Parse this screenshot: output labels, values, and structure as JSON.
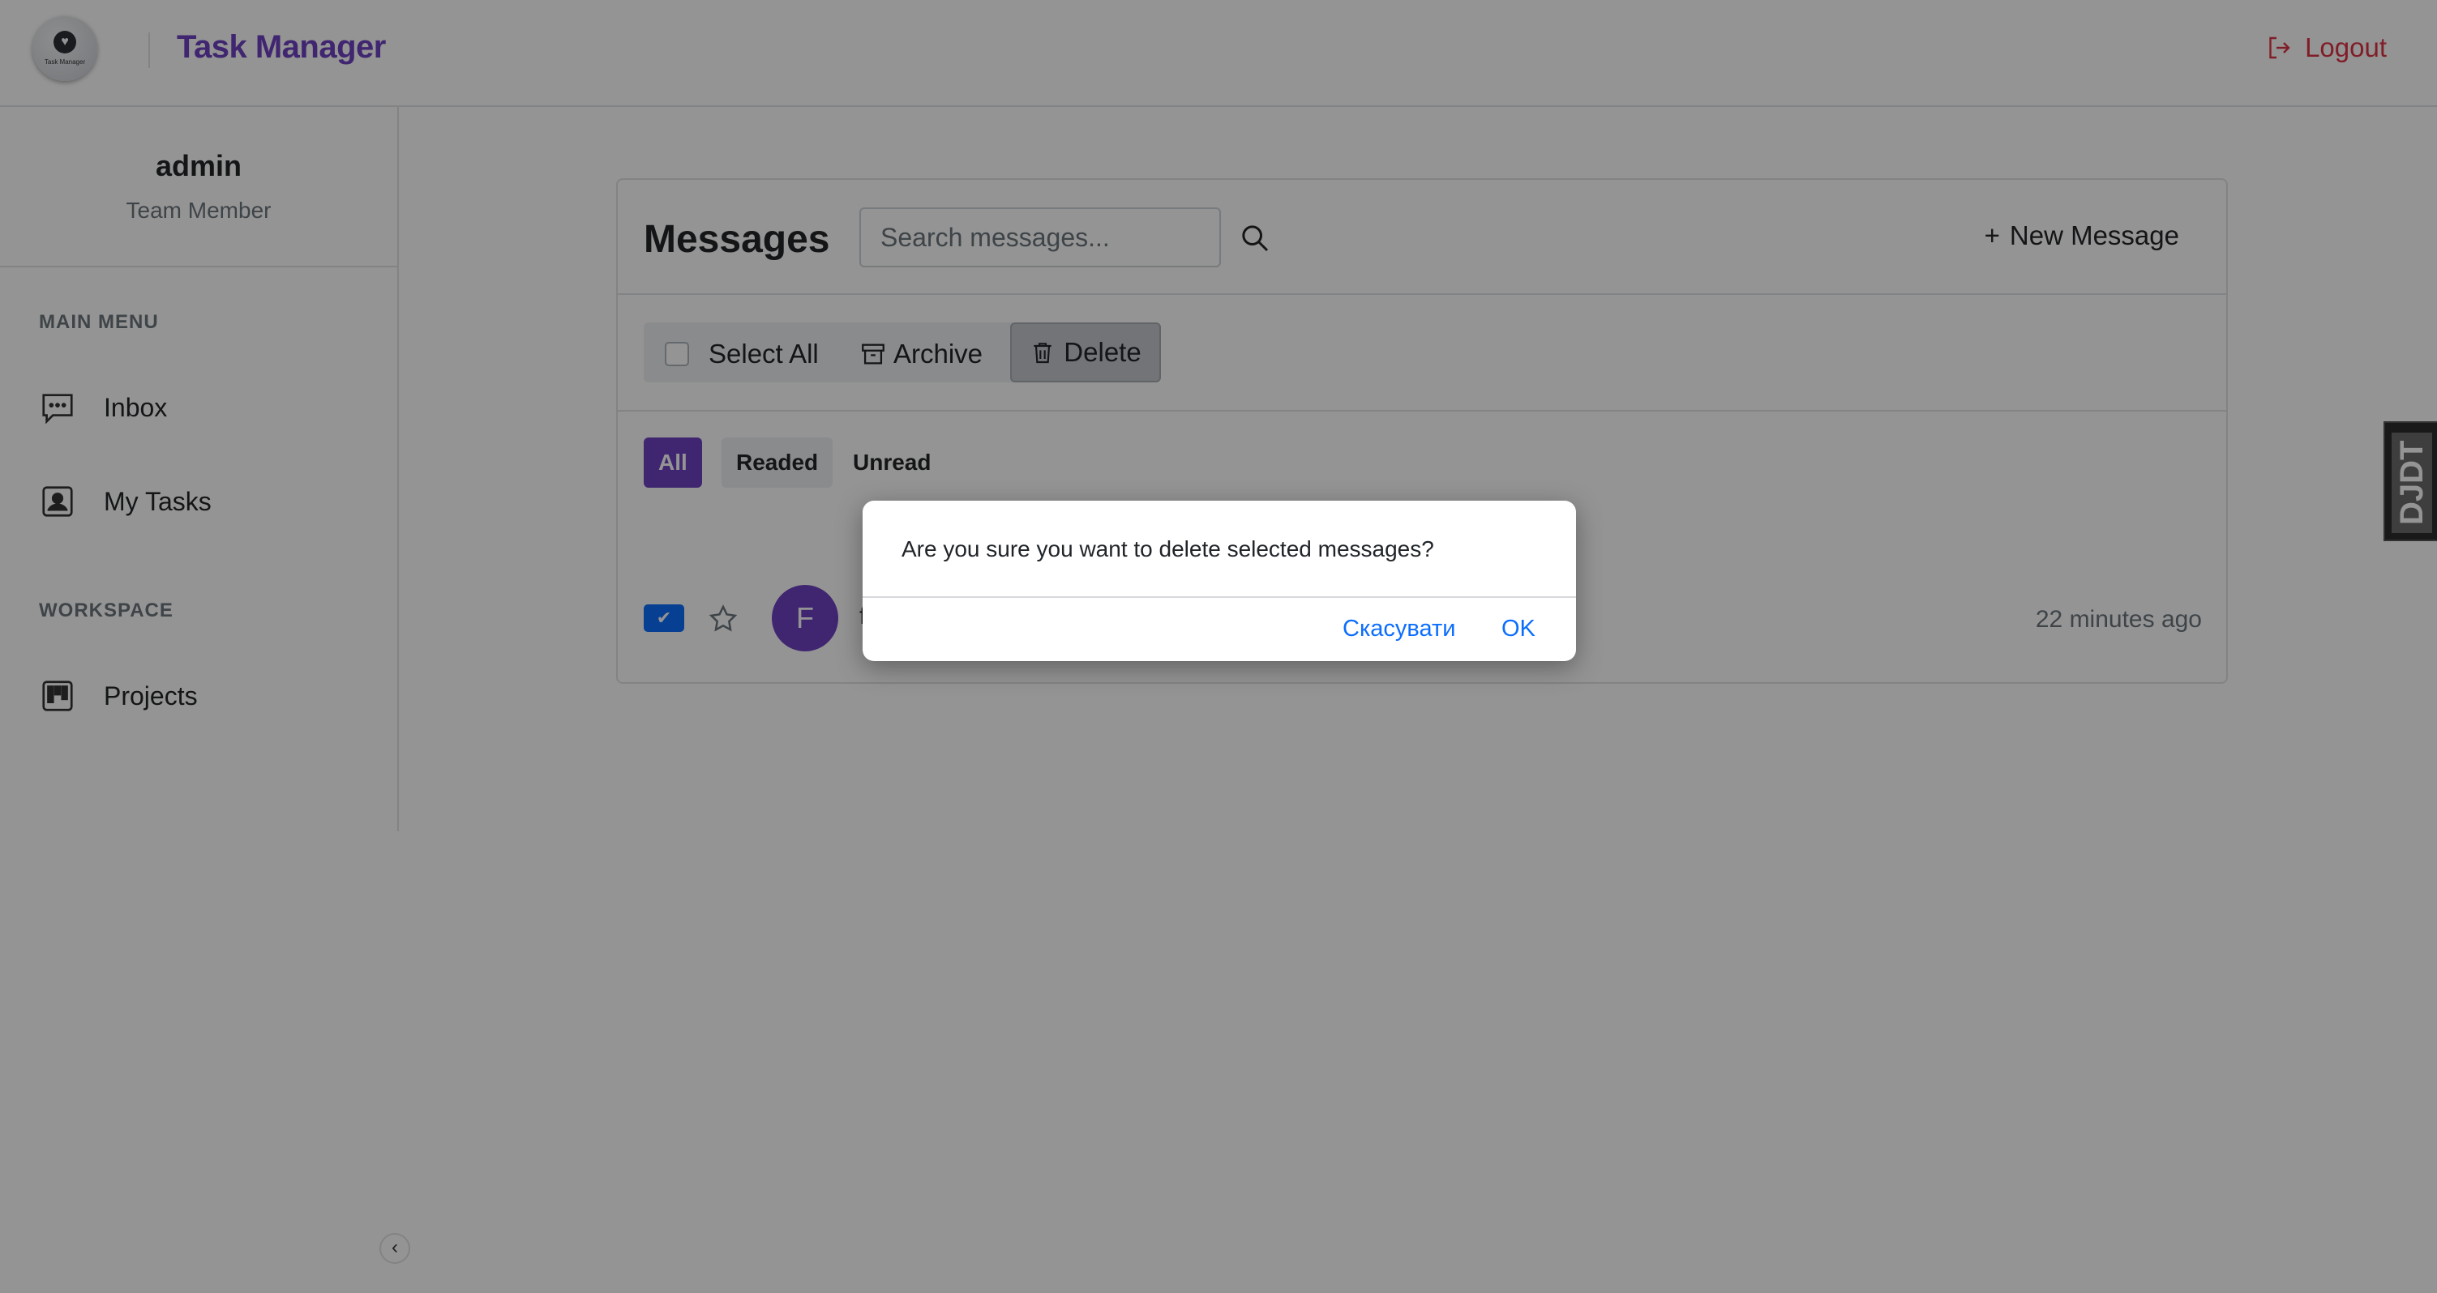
{
  "header": {
    "logo_caption": "Task Manager",
    "brand": "Task Manager",
    "logout_label": "Logout"
  },
  "sidebar": {
    "user_name": "admin",
    "user_role": "Team Member",
    "sections": [
      {
        "title": "MAIN MENU",
        "items": [
          {
            "label": "Inbox",
            "icon": "chat-icon"
          },
          {
            "label": "My Tasks",
            "icon": "user-card-icon"
          }
        ]
      },
      {
        "title": "WORKSPACE",
        "items": [
          {
            "label": "Projects",
            "icon": "kanban-icon"
          }
        ]
      }
    ],
    "collapse_icon": "chevron-left-icon"
  },
  "messages": {
    "title": "Messages",
    "search_placeholder": "Search messages...",
    "new_message_label": "New Message",
    "toolbar": {
      "select_all": "Select All",
      "archive": "Archive",
      "delete": "Delete"
    },
    "filters": {
      "all": "All",
      "readed": "Readed",
      "unread": "Unread"
    },
    "selected_filter": "All",
    "rows": [
      {
        "checked": true,
        "starred": false,
        "avatar_letter": "F",
        "sender": "f",
        "time": "22 minutes ago"
      }
    ]
  },
  "djdt": {
    "label": "DJDT"
  },
  "dialog": {
    "message": "Are you sure you want to delete selected messages?",
    "cancel_label": "Скасувати",
    "ok_label": "OK"
  },
  "colors": {
    "accent": "#6f42c1",
    "link": "#0d6efd",
    "danger": "#dc3545",
    "overlay": "rgba(0,0,0,0.42)"
  }
}
